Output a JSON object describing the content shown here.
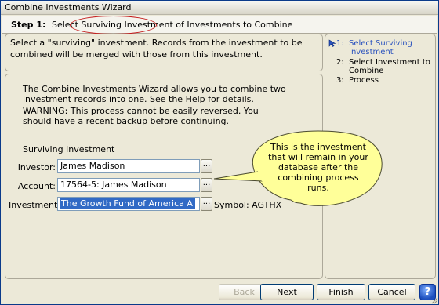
{
  "window": {
    "title": "Combine Investments Wizard"
  },
  "step": {
    "label": "Step 1:",
    "text_before": "Select ",
    "text_highlight": "Surviving Investment",
    "text_after": " of Investments to Combine"
  },
  "intro": {
    "text": "Select a \"surviving\" investment.  Records from the investment to be combined will be merged with those from this investment."
  },
  "main": {
    "description": "The Combine Investments Wizard allows you to combine two investment records into one.  See the Help for details.",
    "warning": "WARNING:  This process cannot be easily reversed. You should have a recent backup before continuing.",
    "section_title": "Surviving Investment",
    "fields": {
      "investor": {
        "label": "Investor:",
        "value": "James Madison",
        "button": "..."
      },
      "account": {
        "label": "Account:",
        "value": "17564-5: James Madison",
        "button": "..."
      },
      "investment": {
        "label": "Investment:",
        "value": "The Growth Fund of America A",
        "button": "..."
      }
    },
    "symbol": "Symbol: AGTHX"
  },
  "callout": {
    "text": "This is the investment that will remain in your database after the combining process runs."
  },
  "steps": [
    {
      "num": "1:",
      "label": "Select Surviving Investment",
      "active": true
    },
    {
      "num": "2:",
      "label": "Select Investment to Combine",
      "active": false
    },
    {
      "num": "3:",
      "label": "Process",
      "active": false
    }
  ],
  "buttons": {
    "back": "Back",
    "next": "Next",
    "finish": "Finish",
    "cancel": "Cancel",
    "help": "?"
  },
  "icons": {
    "current_step": "arrow-pointer-icon",
    "help": "help-icon",
    "resize": "resize-grip-icon"
  }
}
